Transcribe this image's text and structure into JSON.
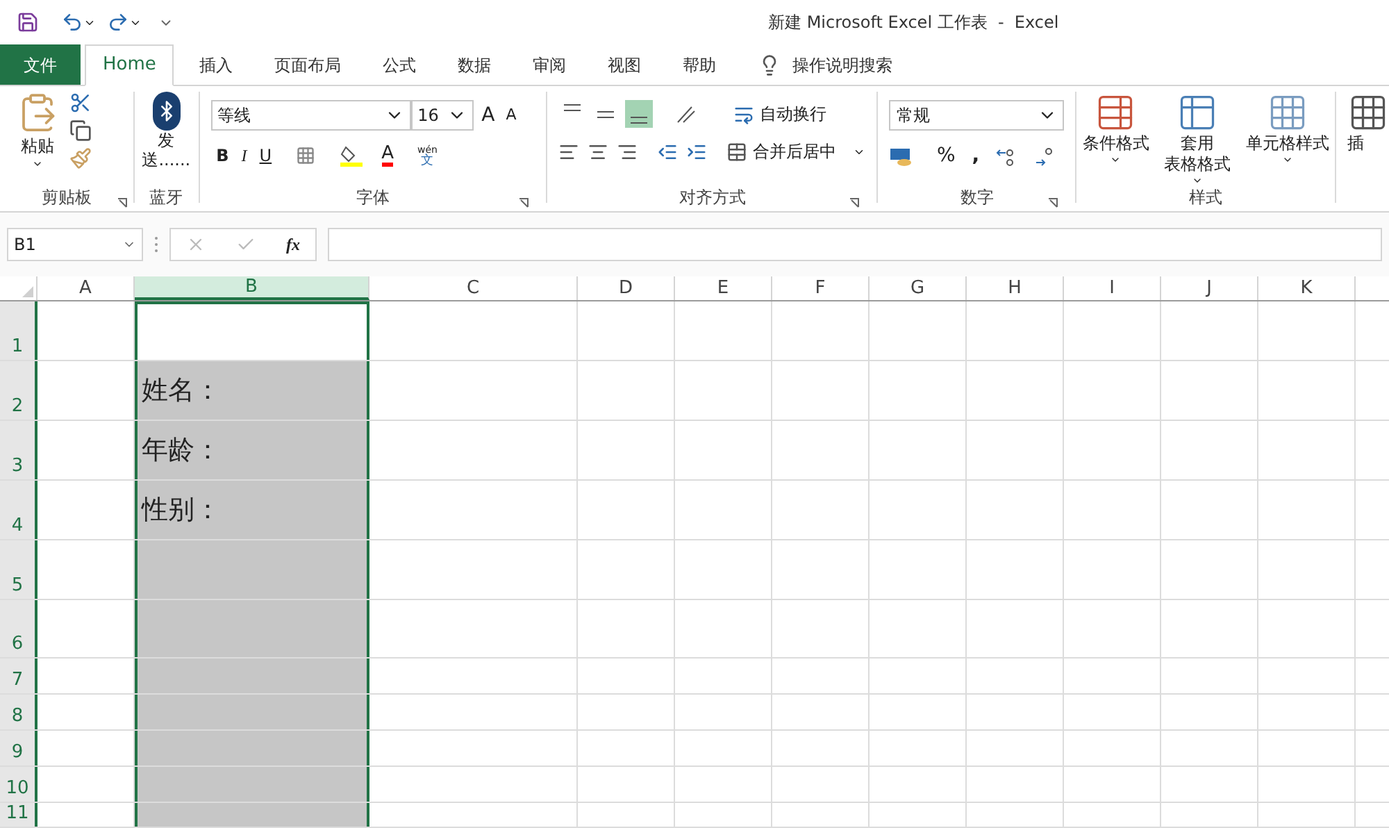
{
  "window": {
    "title": "新建 Microsoft Excel 工作表  -  Excel"
  },
  "tabs": [
    {
      "label": "文件",
      "kind": "file",
      "selected": false
    },
    {
      "label": "Home",
      "kind": "tab",
      "selected": true
    },
    {
      "label": "插入",
      "kind": "tab",
      "selected": false
    },
    {
      "label": "页面布局",
      "kind": "tab",
      "selected": false
    },
    {
      "label": "公式",
      "kind": "tab",
      "selected": false
    },
    {
      "label": "数据",
      "kind": "tab",
      "selected": false
    },
    {
      "label": "审阅",
      "kind": "tab",
      "selected": false
    },
    {
      "label": "视图",
      "kind": "tab",
      "selected": false
    },
    {
      "label": "帮助",
      "kind": "tab",
      "selected": false
    }
  ],
  "tell_me": {
    "placeholder": "操作说明搜索"
  },
  "ribbon": {
    "clipboard": {
      "paste": "粘贴",
      "label": "剪贴板"
    },
    "bluetooth": {
      "send": [
        "发",
        "送......"
      ],
      "label": "蓝牙"
    },
    "font": {
      "font_name": "等线",
      "font_size": "16",
      "grow": "A",
      "shrink": "A",
      "bold": "B",
      "italic": "I",
      "underline": "U",
      "font_color": "A",
      "phonetic": [
        "wén",
        "文"
      ],
      "label": "字体"
    },
    "alignment": {
      "vertical_align": [
        {
          "selected": false
        },
        {
          "selected": false
        },
        {
          "selected": true
        }
      ],
      "wrap": "自动换行",
      "merge": "合并后居中",
      "label": "对齐方式"
    },
    "number": {
      "format": "常规",
      "percent": "%",
      "comma": ",",
      "label": "数字"
    },
    "styles": {
      "buttons": [
        {
          "lines": [
            "条件格式"
          ]
        },
        {
          "lines": [
            "套用",
            "表格格式"
          ]
        },
        {
          "lines": [
            "单元格样式"
          ]
        }
      ],
      "label": "样式"
    },
    "cells": {
      "insert": "插"
    }
  },
  "formula_bar": {
    "name_box": "B1",
    "fx": "fx"
  },
  "columns": [
    {
      "label": "A",
      "selected": false
    },
    {
      "label": "B",
      "selected": true
    },
    {
      "label": "C",
      "selected": false
    },
    {
      "label": "D",
      "selected": false
    },
    {
      "label": "E",
      "selected": false
    },
    {
      "label": "F",
      "selected": false
    },
    {
      "label": "G",
      "selected": false
    },
    {
      "label": "H",
      "selected": false
    },
    {
      "label": "I",
      "selected": false
    },
    {
      "label": "J",
      "selected": false
    },
    {
      "label": "K",
      "selected": false
    }
  ],
  "rows": [
    {
      "label": "1",
      "shaded": false
    },
    {
      "label": "2",
      "shaded": true,
      "column_b": "姓名："
    },
    {
      "label": "3",
      "shaded": true,
      "column_b": "年龄："
    },
    {
      "label": "4",
      "shaded": true,
      "column_b": "性别："
    },
    {
      "label": "5",
      "shaded": true
    },
    {
      "label": "6",
      "shaded": true
    },
    {
      "label": "7",
      "shaded": true
    },
    {
      "label": "8",
      "shaded": true
    },
    {
      "label": "9",
      "shaded": true
    },
    {
      "label": "10",
      "shaded": true
    },
    {
      "label": "11",
      "shaded": true
    }
  ]
}
